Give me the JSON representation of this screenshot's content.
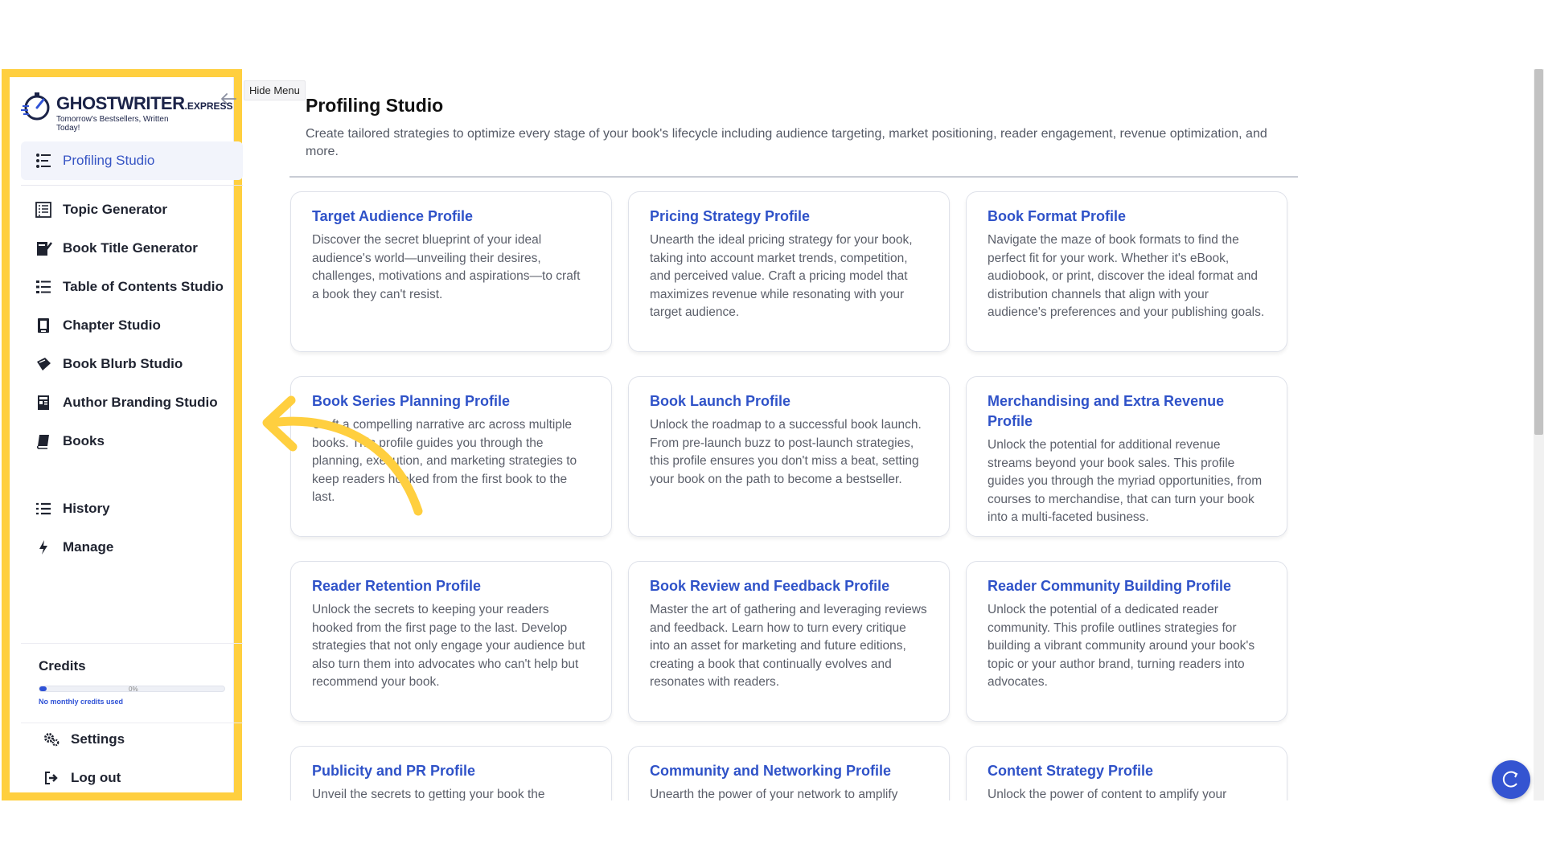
{
  "app": {
    "logo_brand": "GHOSTWRITER",
    "logo_suffix": ".EXPRESS",
    "logo_tagline": "Tomorrow's Bestsellers, Written Today!",
    "hide_menu_label": "Hide Menu"
  },
  "sidebar": {
    "items": [
      {
        "label": "Profiling Studio",
        "icon": "profiling-icon",
        "active": true
      },
      {
        "label": "Topic Generator",
        "icon": "topic-icon"
      },
      {
        "label": "Book Title Generator",
        "icon": "title-icon"
      },
      {
        "label": "Table of Contents Studio",
        "icon": "toc-icon"
      },
      {
        "label": "Chapter Studio",
        "icon": "chapter-icon"
      },
      {
        "label": "Book Blurb Studio",
        "icon": "blurb-icon"
      },
      {
        "label": "Author Branding Studio",
        "icon": "branding-icon"
      },
      {
        "label": "Books",
        "icon": "books-icon"
      }
    ],
    "secondary": [
      {
        "label": "History",
        "icon": "list-icon"
      },
      {
        "label": "Manage",
        "icon": "bolt-icon"
      }
    ],
    "credits": {
      "title": "Credits",
      "percent_label": "0%",
      "percent": 0,
      "note": "No monthly credits used"
    },
    "bottom": [
      {
        "label": "Settings",
        "icon": "gears-icon"
      },
      {
        "label": "Log out",
        "icon": "logout-icon"
      }
    ]
  },
  "main": {
    "title": "Profiling Studio",
    "description": "Create tailored strategies to optimize every stage of your book's lifecycle including audience targeting, market positioning, reader engagement, revenue optimization, and more.",
    "cards": [
      {
        "title": "Target Audience Profile",
        "desc": "Discover the secret blueprint of your ideal audience's world—unveiling their desires, challenges, motivations and aspirations—to craft a book they can't resist."
      },
      {
        "title": "Pricing Strategy Profile",
        "desc": "Unearth the ideal pricing strategy for your book, taking into account market trends, competition, and perceived value. Craft a pricing model that maximizes revenue while resonating with your target audience."
      },
      {
        "title": "Book Format Profile",
        "desc": "Navigate the maze of book formats to find the perfect fit for your work. Whether it's eBook, audiobook, or print, discover the ideal format and distribution channels that align with your audience's preferences and your publishing goals."
      },
      {
        "title": "Book Series Planning Profile",
        "desc": "Craft a compelling narrative arc across multiple books. This profile guides you through the planning, execution, and marketing strategies to keep readers hooked from the first book to the last."
      },
      {
        "title": "Book Launch Profile",
        "desc": "Unlock the roadmap to a successful book launch. From pre-launch buzz to post-launch strategies, this profile ensures you don't miss a beat, setting your book on the path to become a bestseller."
      },
      {
        "title": "Merchandising and Extra Revenue Profile",
        "desc": "Unlock the potential for additional revenue streams beyond your book sales. This profile guides you through the myriad opportunities, from courses to merchandise, that can turn your book into a multi-faceted business."
      },
      {
        "title": "Reader Retention Profile",
        "desc": "Unlock the secrets to keeping your readers hooked from the first page to the last. Develop strategies that not only engage your audience but also turn them into advocates who can't help but recommend your book."
      },
      {
        "title": "Book Review and Feedback Profile",
        "desc": "Master the art of gathering and leveraging reviews and feedback. Learn how to turn every critique into an asset for marketing and future editions, creating a book that continually evolves and resonates with readers."
      },
      {
        "title": "Reader Community Building Profile",
        "desc": "Unlock the potential of a dedicated reader community. This profile outlines strategies for building a vibrant community around your book's topic or your author brand, turning readers into advocates."
      },
      {
        "title": "Publicity and PR Profile",
        "desc": "Unveil the secrets to getting your book the"
      },
      {
        "title": "Community and Networking Profile",
        "desc": "Unearth the power of your network to amplify"
      },
      {
        "title": "Content Strategy Profile",
        "desc": "Unlock the power of content to amplify your"
      }
    ]
  },
  "colors": {
    "accent": "#2f52c8",
    "highlight": "#ffcf3f"
  }
}
